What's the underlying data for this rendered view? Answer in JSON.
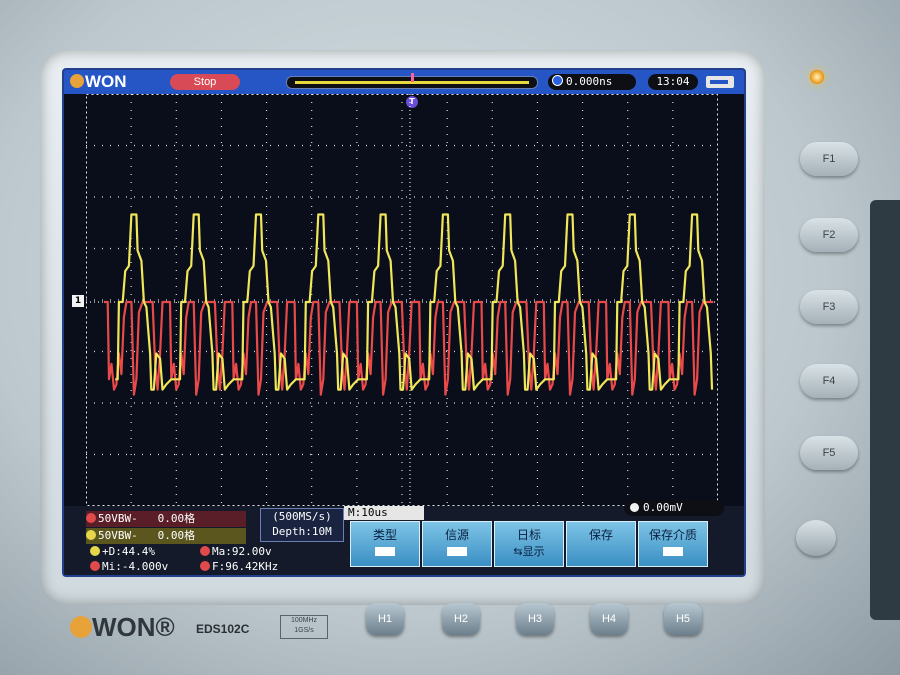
{
  "brand": {
    "logo": "WON",
    "model": "EDS102C",
    "spec_lines": [
      "100MHz",
      "1GS/s"
    ]
  },
  "status": {
    "run_state": "Stop",
    "time_offset": "0.000ns",
    "clock": "13:04"
  },
  "channels": [
    {
      "label": "50VBW-",
      "value": "0.00格",
      "color": "#e04a4a"
    },
    {
      "label": "50VBW-",
      "value": "0.00格",
      "color": "#e6d64a"
    }
  ],
  "measurements": [
    {
      "text": "+D:44.4%",
      "color": "#e6d64a"
    },
    {
      "text": "Ma:92.00v",
      "color": "#e04a4a"
    },
    {
      "text": "Mi:-4.000v",
      "color": "#e04a4a"
    },
    {
      "text": "F:96.42KHz",
      "color": "#e04a4a"
    }
  ],
  "acquisition": {
    "rate": "(500MS/s)",
    "depth": "Depth:10M",
    "timebase": "M:10us"
  },
  "trigger": {
    "level": "0.00mV"
  },
  "menu": [
    {
      "label": "类型",
      "sub": ""
    },
    {
      "label": "信源",
      "sub": ""
    },
    {
      "label": "日标",
      "sub": "⇆显示"
    },
    {
      "label": "保存",
      "sub": ""
    },
    {
      "label": "保存介质",
      "sub": ""
    }
  ],
  "side_buttons": [
    "F1",
    "F2",
    "F3",
    "F4",
    "F5"
  ],
  "bottom_buttons": [
    "H1",
    "H2",
    "H3",
    "H4",
    "H5"
  ],
  "waveform": {
    "colors": {
      "ch1": "#e84a4a",
      "ch2": "#f0e65a",
      "grid": "#ffffff"
    },
    "period_div": 1.38,
    "divisions": [
      10,
      8
    ]
  }
}
